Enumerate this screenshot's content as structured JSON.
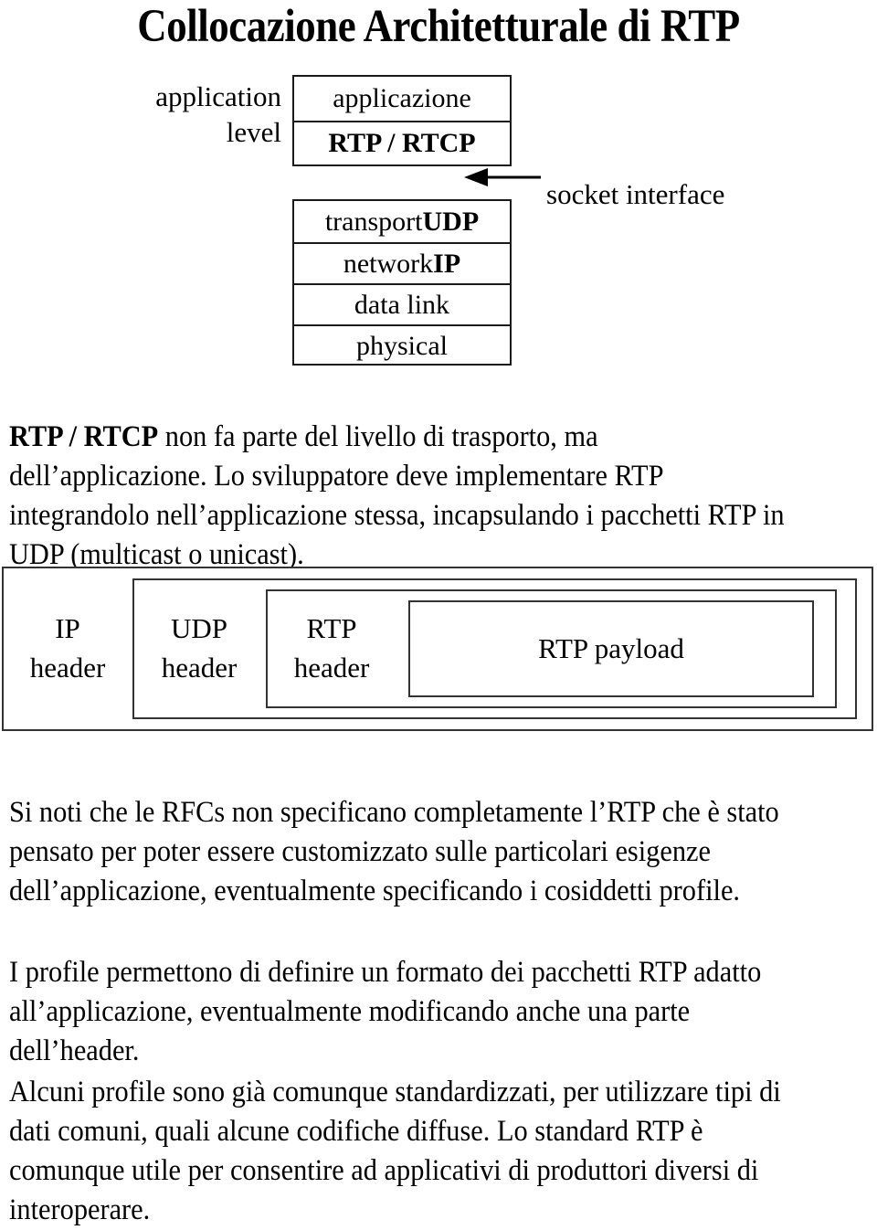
{
  "slide": {
    "title": "Collocazione Architetturale di RTP"
  },
  "stack_diagram": {
    "side_label_line1": "application",
    "side_label_line2": "level",
    "upper_box_rows": [
      {
        "text": "applicazione",
        "bold": false
      },
      {
        "text": "RTP / RTCP",
        "bold": true
      }
    ],
    "lower_box_rows": [
      {
        "prefix": "transport ",
        "bold_part": "UDP"
      },
      {
        "prefix": "network ",
        "bold_part": "IP"
      },
      {
        "prefix": "data link",
        "bold_part": ""
      },
      {
        "prefix": "physical",
        "bold_part": ""
      }
    ],
    "arrow": {
      "icon": "arrow-left-icon",
      "direction": "left"
    },
    "annotation": "socket interface"
  },
  "paragraphs": {
    "intro_bold_lead": "RTP / RTCP",
    "intro_rest": " non fa parte del livello di trasporto, ma dell’applicazione. Lo sviluppatore deve implementare RTP integrandolo nell’applicazione stessa, incapsulando i pacchetti RTP in UDP (multicast o unicast).",
    "rfcs": "Si noti che le RFCs non specificano completamente l’RTP che è stato pensato per poter essere customizzato sulle particolari esigenze dell’applicazione, eventualmente specificando i cosiddetti profile.",
    "profile": "I profile permettono di definire un formato dei pacchetti RTP adatto all’applicazione, eventualmente modificando anche una parte dell’header.",
    "standard": "Alcuni profile sono già comunque standardizzati, per utilizzare tipi di dati comuni, quali alcune codifiche diffuse. Lo standard RTP è comunque utile per consentire ad applicativi di produttori diversi di interoperare."
  },
  "packet_diagram": {
    "layers": [
      {
        "line1": "IP",
        "line2": "header"
      },
      {
        "line1": "UDP",
        "line2": "header"
      },
      {
        "line1": "RTP",
        "line2": "header"
      }
    ],
    "payload_label": "RTP payload"
  },
  "colors": {
    "text": "#000000",
    "border": "#333333",
    "background": "#ffffff"
  }
}
